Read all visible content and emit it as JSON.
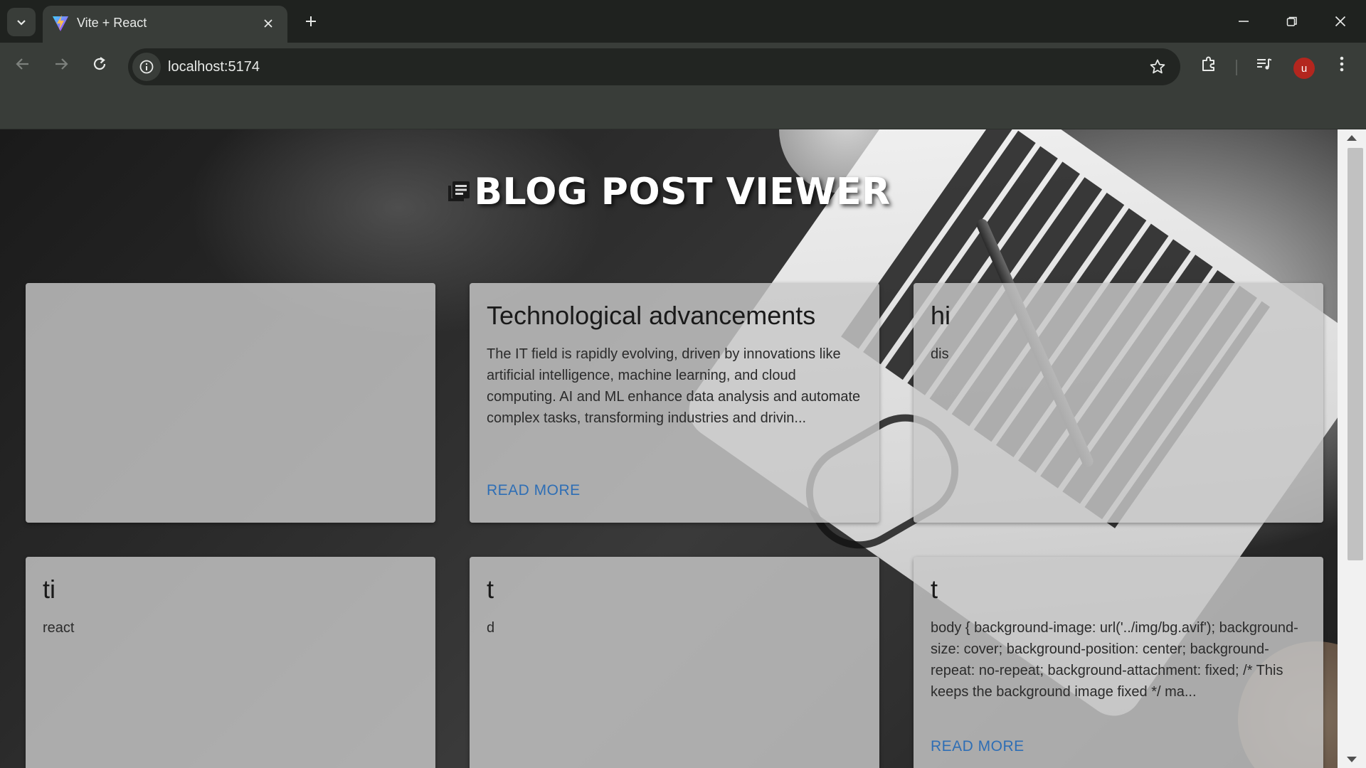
{
  "browser": {
    "tab_title": "Vite + React",
    "url": "localhost:5174",
    "profile_initial": "u"
  },
  "page": {
    "title": "BLOG POST VIEWER",
    "posts": [
      {
        "title": "",
        "body": "",
        "read_more": ""
      },
      {
        "title": "Technological advancements",
        "body": "The IT field is rapidly evolving, driven by innovations like artificial intelligence, machine learning, and cloud computing. AI and ML enhance data analysis and automate complex tasks, transforming industries and drivin...",
        "read_more": "READ MORE"
      },
      {
        "title": "hi",
        "body": "dis",
        "read_more": ""
      },
      {
        "title": "ti",
        "body": "react",
        "read_more": ""
      },
      {
        "title": "t",
        "body": "d",
        "read_more": ""
      },
      {
        "title": "t",
        "body": "body { background-image: url('../img/bg.avif'); background-size: cover; background-position: center; background-repeat: no-repeat; background-attachment: fixed; /* This keeps the background image fixed */ ma...",
        "read_more": "READ MORE"
      }
    ]
  },
  "colors": {
    "chrome_dark": "#1f221f",
    "chrome_toolbar": "#393d39",
    "link_blue": "#2e6eb5",
    "avatar_red": "#b3261e"
  }
}
